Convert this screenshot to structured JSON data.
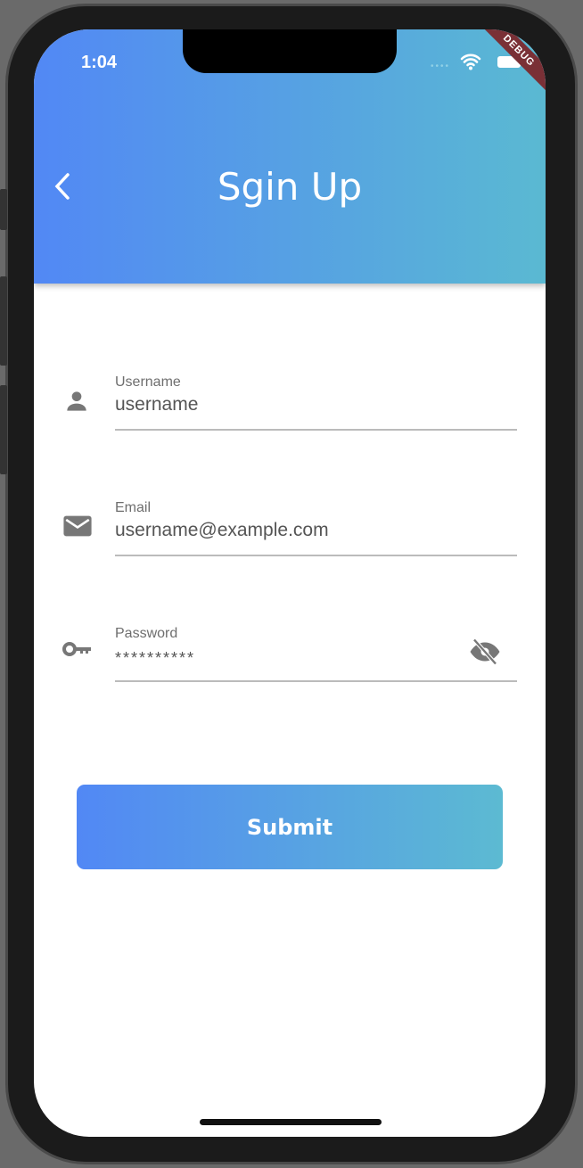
{
  "status_bar": {
    "time": "1:04",
    "debug_banner": "DEBUG"
  },
  "header": {
    "title": "Sgin Up"
  },
  "form": {
    "username": {
      "label": "Username",
      "value": "username"
    },
    "email": {
      "label": "Email",
      "value": "username@example.com"
    },
    "password": {
      "label": "Password",
      "value": "**********"
    }
  },
  "submit_label": "Submit",
  "colors": {
    "gradient_start": "#5288f5",
    "gradient_end": "#5ab9d2"
  }
}
